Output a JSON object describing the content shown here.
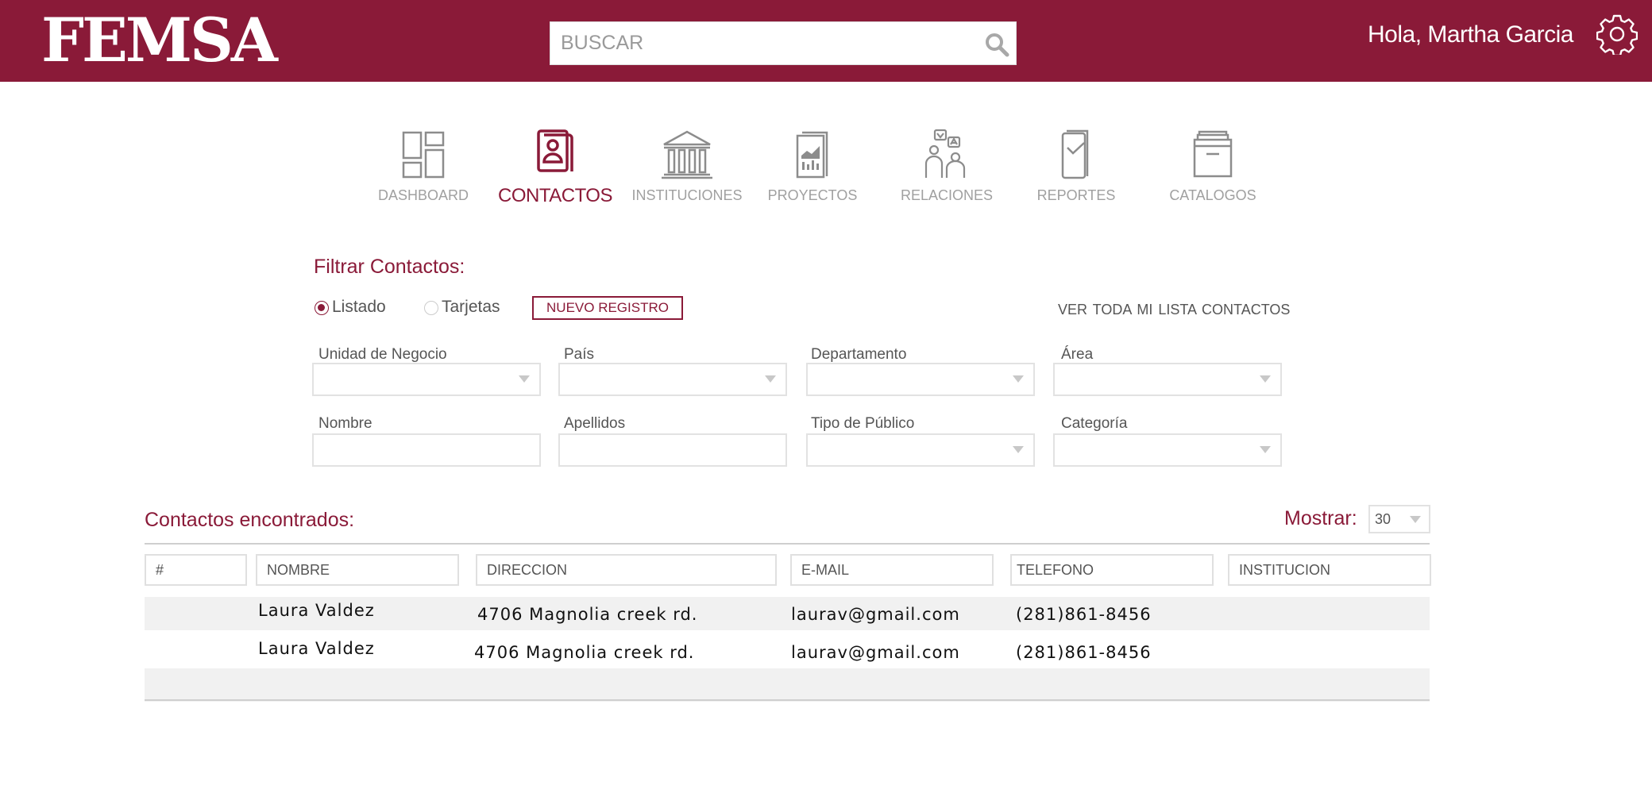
{
  "header": {
    "logo_text": "FEMSA",
    "search_placeholder": "BUSCAR",
    "greeting": "Hola, Martha Garcia",
    "icons": {
      "search": "search-icon",
      "settings": "gear-icon"
    }
  },
  "nav": {
    "active": "CONTACTOS",
    "items": [
      {
        "label": "DASHBOARD",
        "icon": "dashboard-icon"
      },
      {
        "label": "CONTACTOS",
        "icon": "contacts-icon"
      },
      {
        "label": "INSTITUCIONES",
        "icon": "institution-icon"
      },
      {
        "label": "PROYECTOS",
        "icon": "projects-icon"
      },
      {
        "label": "RELACIONES",
        "icon": "relations-icon"
      },
      {
        "label": "REPORTES",
        "icon": "reports-icon"
      },
      {
        "label": "CATALOGOS",
        "icon": "catalogs-icon"
      }
    ]
  },
  "filter": {
    "title": "Filtrar Contactos:",
    "view_options": [
      {
        "label": "Listado",
        "selected": true
      },
      {
        "label": "Tarjetas",
        "selected": false
      }
    ],
    "new_button": "NUEVO REGISTRO",
    "view_all_link": "VER TODA MI LISTA CONTACTOS",
    "fields": [
      {
        "label": "Unidad de Negocio",
        "type": "select",
        "value": ""
      },
      {
        "label": "País",
        "type": "select",
        "value": ""
      },
      {
        "label": "Departamento",
        "type": "select",
        "value": ""
      },
      {
        "label": "Área",
        "type": "select",
        "value": ""
      },
      {
        "label": "Nombre",
        "type": "text",
        "value": ""
      },
      {
        "label": "Apellidos",
        "type": "text",
        "value": ""
      },
      {
        "label": "Tipo de Público",
        "type": "select",
        "value": ""
      },
      {
        "label": "Categoría",
        "type": "select",
        "value": ""
      }
    ]
  },
  "results": {
    "title": "Contactos encontrados:",
    "show_label": "Mostrar:",
    "show_value": "30",
    "columns": [
      "#",
      "NOMBRE",
      "DIRECCION",
      "E-MAIL",
      "TELEFONO",
      "INSTITUCION"
    ],
    "rows": [
      {
        "num": "",
        "nombre": "Laura Valdez",
        "direccion": "4706 Magnolia creek rd.",
        "email": "laurav@gmail.com",
        "telefono": "(281)861-8456",
        "institucion": ""
      },
      {
        "num": "",
        "nombre": "Laura Valdez",
        "direccion": "4706 Magnolia creek rd.",
        "email": "laurav@gmail.com",
        "telefono": "(281)861-8456",
        "institucion": ""
      }
    ]
  },
  "colors": {
    "brand": "#8a1a38",
    "icon_gray": "#8c8c8c",
    "label_gray": "#a0a0a0",
    "row_bg": "#f1f1f1"
  }
}
